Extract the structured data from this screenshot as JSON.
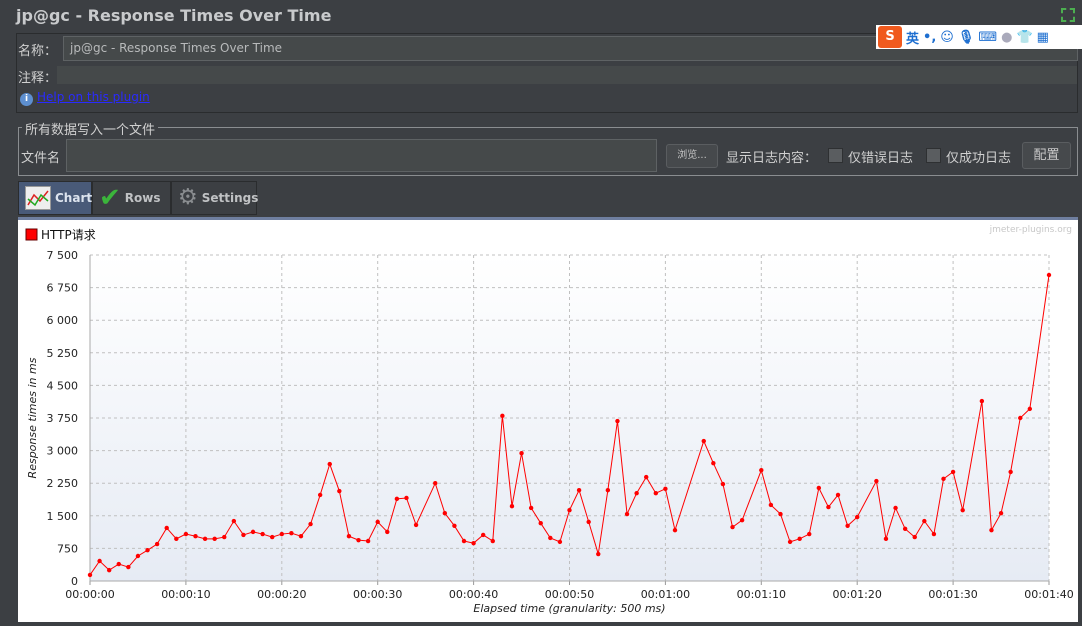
{
  "window": {
    "title": "jp@gc - Response Times Over Time"
  },
  "form": {
    "name_label": "名称：",
    "name_value": "jp@gc - Response Times Over Time",
    "comment_label": "注释：",
    "comment_value": "",
    "help_link": "Help on this plugin"
  },
  "file_section": {
    "legend": "所有数据写入一个文件",
    "filename_label": "文件名",
    "filename_value": "",
    "browse_button": "浏览...",
    "log_label": "显示日志内容：",
    "errors_only": "仅错误日志",
    "errors_only_checked": false,
    "success_only": "仅成功日志",
    "success_only_checked": false,
    "config_button": "配置"
  },
  "ime_toolbar": {
    "mode": "英",
    "punct": "•,"
  },
  "tabs": [
    {
      "label": "Chart",
      "active": true
    },
    {
      "label": "Rows",
      "active": false
    },
    {
      "label": "Settings",
      "active": false
    }
  ],
  "chart_data": {
    "type": "line",
    "watermark": "jmeter-plugins.org",
    "xlabel": "Elapsed time (granularity: 500 ms)",
    "ylabel": "Response times in ms",
    "xlim": [
      0,
      100
    ],
    "ylim": [
      0,
      7500
    ],
    "x_ticks": [
      "00:00:00",
      "00:00:10",
      "00:00:20",
      "00:00:30",
      "00:00:40",
      "00:00:50",
      "00:01:00",
      "00:01:10",
      "00:01:20",
      "00:01:30",
      "00:01:40"
    ],
    "y_ticks": [
      "0",
      "750",
      "1 500",
      "2 250",
      "3 000",
      "3 750",
      "4 500",
      "5 250",
      "6 000",
      "6 750",
      "7 500"
    ],
    "grid": true,
    "legend_position": "top-left",
    "series": [
      {
        "name": "HTTP请求",
        "color": "#ff0000",
        "x": [
          0,
          1,
          2,
          3,
          4,
          5,
          6,
          7,
          8,
          9,
          10,
          11,
          12,
          13,
          14,
          15,
          16,
          17,
          18,
          19,
          20,
          21,
          22,
          23,
          24,
          25,
          26,
          27,
          28,
          29,
          30,
          31,
          32,
          33,
          34,
          36,
          37,
          38,
          39,
          40,
          41,
          42,
          43,
          44,
          45,
          46,
          47,
          48,
          49,
          50,
          51,
          52,
          53,
          54,
          55,
          56,
          57,
          58,
          59,
          60,
          61,
          64,
          65,
          66,
          67,
          68,
          70,
          71,
          72,
          73,
          74,
          75,
          76,
          77,
          78,
          79,
          80,
          82,
          83,
          84,
          85,
          86,
          87,
          88,
          89,
          90,
          91,
          93,
          94,
          95,
          96,
          97,
          98,
          100
        ],
        "y": [
          140,
          460,
          250,
          390,
          320,
          575,
          710,
          850,
          1220,
          970,
          1080,
          1030,
          970,
          970,
          1010,
          1380,
          1060,
          1130,
          1080,
          1010,
          1080,
          1100,
          1030,
          1310,
          1980,
          2690,
          2070,
          1030,
          940,
          920,
          1360,
          1130,
          1890,
          1910,
          1290,
          2250,
          1560,
          1270,
          920,
          870,
          1060,
          920,
          3800,
          1720,
          2940,
          1680,
          1330,
          990,
          900,
          1630,
          2090,
          1360,
          620,
          2090,
          3680,
          1540,
          2020,
          2390,
          2020,
          2120,
          1170,
          3220,
          2710,
          2230,
          1240,
          1400,
          2550,
          1750,
          1540,
          900,
          970,
          1080,
          2140,
          1700,
          1980,
          1270,
          1470,
          2300,
          970,
          1680,
          1200,
          1010,
          1380,
          1080,
          2350,
          2510,
          1630,
          4140,
          1170,
          1560,
          2510,
          3750,
          3960,
          7040
        ]
      }
    ]
  }
}
